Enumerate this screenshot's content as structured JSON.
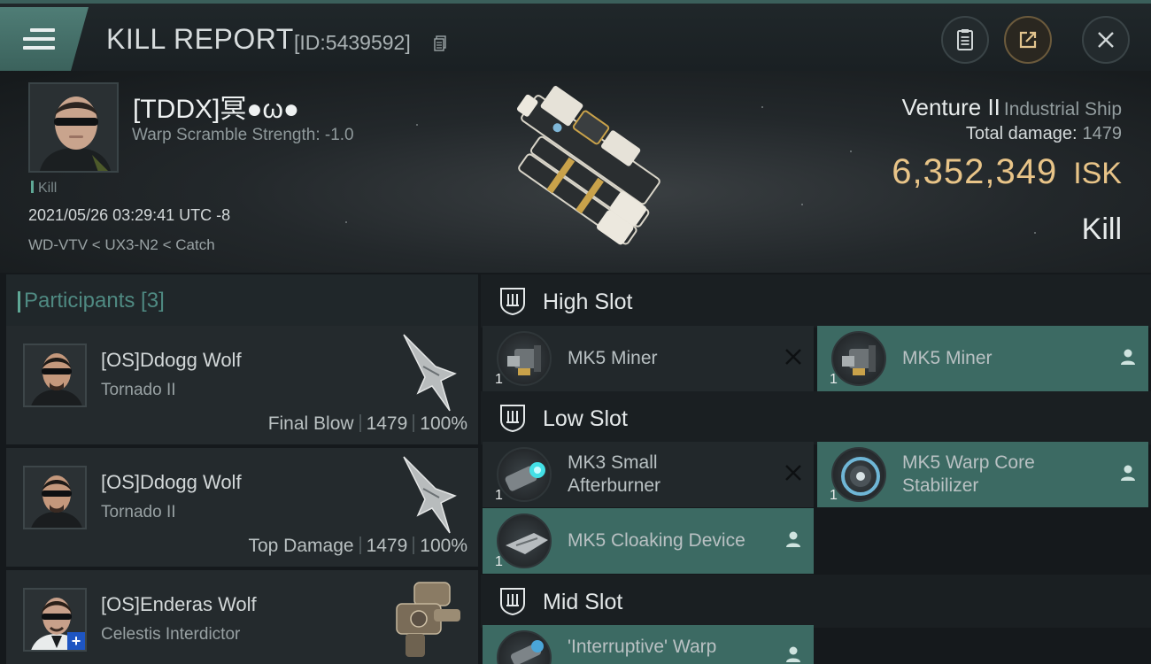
{
  "header": {
    "title": "KILL REPORT",
    "report_id": "[ID:5439592]",
    "icons": [
      "menu-icon",
      "copy-icon",
      "clipboard-icon",
      "share-icon",
      "close-icon"
    ]
  },
  "victim": {
    "name": "[TDDX]冥●ω●",
    "warp_scramble": "Warp Scramble Strength: -1.0",
    "tag": "Kill",
    "timestamp": "2021/05/26 03:29:41 UTC -8",
    "location": "WD-VTV < UX3-N2 < Catch"
  },
  "ship": {
    "name": "Venture II",
    "class": "Industrial Ship",
    "total_damage_label": "Total damage:",
    "total_damage": "1479",
    "isk_value": "6,352,349",
    "isk_unit": "ISK",
    "result": "Kill"
  },
  "participants": {
    "title": "Participants [3]",
    "items": [
      {
        "name": "[OS]Ddogg Wolf",
        "ship": "Tornado II",
        "role": "Final Blow",
        "damage": "1479",
        "percent": "100%"
      },
      {
        "name": "[OS]Ddogg Wolf",
        "ship": "Tornado II",
        "role": "Top Damage",
        "damage": "1479",
        "percent": "100%"
      },
      {
        "name": "[OS]Enderas Wolf",
        "ship": "Celestis Interdictor",
        "role": "",
        "damage": "",
        "percent": ""
      }
    ]
  },
  "slots": {
    "high": {
      "label": "High Slot",
      "modules": [
        {
          "name": "MK5 Miner",
          "qty": "1",
          "status": "destroyed"
        },
        {
          "name": "MK5 Miner",
          "qty": "1",
          "status": "dropped"
        }
      ]
    },
    "low": {
      "label": "Low Slot",
      "modules": [
        {
          "name": "MK3 Small Afterburner",
          "line1": "MK3 Small",
          "line2": "Afterburner",
          "qty": "1",
          "status": "destroyed"
        },
        {
          "name": "MK5 Warp Core Stabilizer",
          "line1": "MK5 Warp Core",
          "line2": "Stabilizer",
          "qty": "1",
          "status": "dropped"
        },
        {
          "name": "MK5 Cloaking Device",
          "qty": "1",
          "status": "dropped"
        }
      ]
    },
    "mid": {
      "label": "Mid Slot",
      "modules": [
        {
          "name": "'Interruptive' Warp",
          "qty": "",
          "status": "dropped"
        }
      ]
    }
  },
  "colors": {
    "accent_teal": "#3c6a63",
    "isk_gold": "#e8c488",
    "participants_title": "#4f8a82"
  }
}
